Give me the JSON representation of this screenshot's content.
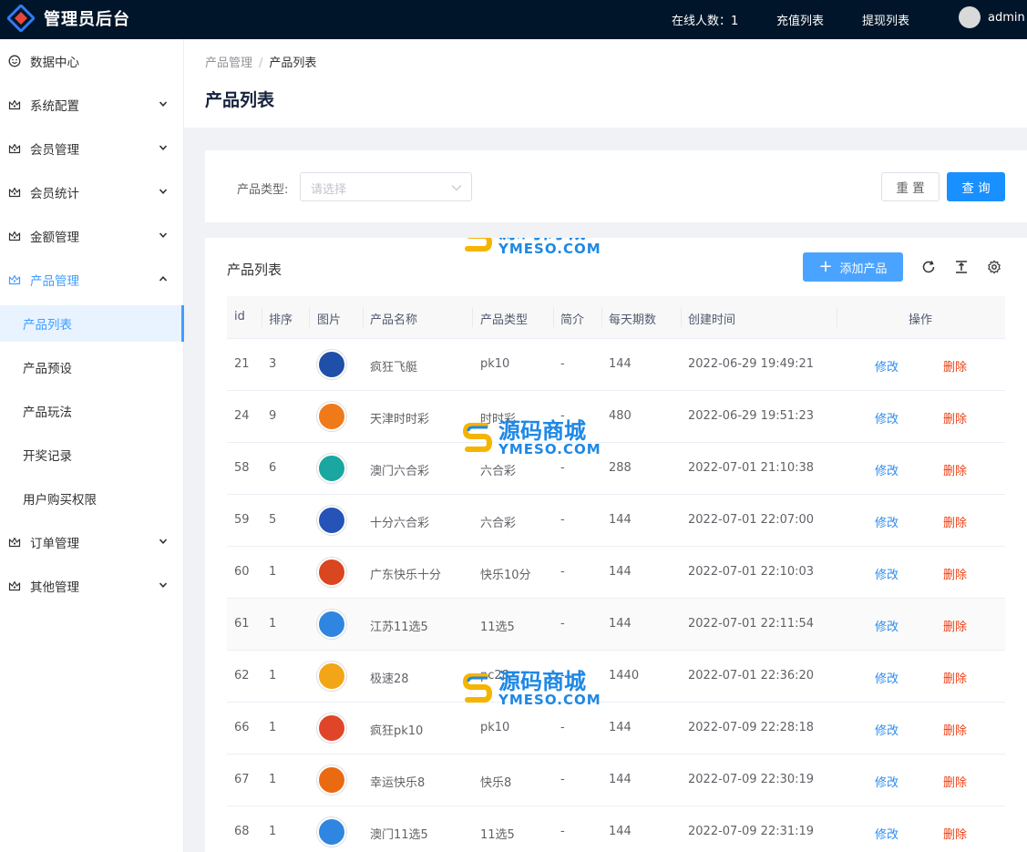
{
  "header": {
    "title": "管理员后台",
    "online_label": "在线人数：1",
    "links": [
      "充值列表",
      "提现列表"
    ],
    "username": "admin"
  },
  "sidebar": {
    "items": [
      {
        "label": "数据中心",
        "icon": "dashboard-icon",
        "has_arrow": false
      },
      {
        "label": "系统配置",
        "icon": "crown-icon",
        "has_arrow": true
      },
      {
        "label": "会员管理",
        "icon": "crown-icon",
        "has_arrow": true
      },
      {
        "label": "会员统计",
        "icon": "crown-icon",
        "has_arrow": true
      },
      {
        "label": "金额管理",
        "icon": "crown-icon",
        "has_arrow": true
      },
      {
        "label": "产品管理",
        "icon": "crown-icon",
        "has_arrow": true,
        "open": true
      },
      {
        "label": "订单管理",
        "icon": "crown-icon",
        "has_arrow": true
      },
      {
        "label": "其他管理",
        "icon": "crown-icon",
        "has_arrow": true
      }
    ],
    "sub_items": [
      "产品列表",
      "产品预设",
      "产品玩法",
      "开奖记录",
      "用户购买权限"
    ],
    "active_sub": "产品列表"
  },
  "breadcrumb": {
    "parent": "产品管理",
    "separator": "/",
    "current": "产品列表"
  },
  "page_title": "产品列表",
  "filter": {
    "label": "产品类型:",
    "placeholder": "请选择",
    "reset_label": "重 置",
    "query_label": "查 询"
  },
  "table_card": {
    "title": "产品列表",
    "add_label": "添加产品",
    "tool_icons": [
      "refresh-icon",
      "column-height-icon",
      "settings-icon"
    ],
    "columns": [
      "id",
      "排序",
      "图片",
      "产品名称",
      "产品类型",
      "简介",
      "每天期数",
      "创建时间",
      "操作"
    ],
    "edit_label": "修改",
    "delete_label": "删除",
    "rows": [
      {
        "id": "21",
        "sort": "3",
        "name": "疯狂飞艇",
        "type": "pk10",
        "intro": "-",
        "daily": "144",
        "created": "2022-06-29 19:49:21",
        "icon_color": "#1f4fa8"
      },
      {
        "id": "24",
        "sort": "9",
        "name": "天津时时彩",
        "type": "时时彩",
        "intro": "-",
        "daily": "480",
        "created": "2022-06-29 19:51:23",
        "icon_color": "#f07a1a"
      },
      {
        "id": "58",
        "sort": "6",
        "name": "澳门六合彩",
        "type": "六合彩",
        "intro": "-",
        "daily": "288",
        "created": "2022-07-01 21:10:38",
        "icon_color": "#19a7a0"
      },
      {
        "id": "59",
        "sort": "5",
        "name": "十分六合彩",
        "type": "六合彩",
        "intro": "-",
        "daily": "144",
        "created": "2022-07-01 22:07:00",
        "icon_color": "#2653b8"
      },
      {
        "id": "60",
        "sort": "1",
        "name": "广东快乐十分",
        "type": "快乐10分",
        "intro": "-",
        "daily": "144",
        "created": "2022-07-01 22:10:03",
        "icon_color": "#d9461f"
      },
      {
        "id": "61",
        "sort": "1",
        "name": "江苏11选5",
        "type": "11选5",
        "intro": "-",
        "daily": "144",
        "created": "2022-07-01 22:11:54",
        "icon_color": "#2f86e0"
      },
      {
        "id": "62",
        "sort": "1",
        "name": "极速28",
        "type": "pc28",
        "intro": "-",
        "daily": "1440",
        "created": "2022-07-01 22:36:20",
        "icon_color": "#f2a516"
      },
      {
        "id": "66",
        "sort": "1",
        "name": "疯狂pk10",
        "type": "pk10",
        "intro": "-",
        "daily": "144",
        "created": "2022-07-09 22:28:18",
        "icon_color": "#e0452a"
      },
      {
        "id": "67",
        "sort": "1",
        "name": "幸运快乐8",
        "type": "快乐8",
        "intro": "-",
        "daily": "144",
        "created": "2022-07-09 22:30:19",
        "icon_color": "#ea6a12"
      },
      {
        "id": "68",
        "sort": "1",
        "name": "澳门11选5",
        "type": "11选5",
        "intro": "-",
        "daily": "144",
        "created": "2022-07-09 22:31:19",
        "icon_color": "#2f86e0"
      }
    ]
  },
  "watermark": {
    "cn": "源码商城",
    "en": "YMESO.COM"
  },
  "colors": {
    "header_bg": "#001529",
    "primary": "#1890ff",
    "link": "#2d8cf0",
    "danger": "#ed4014",
    "active_bg": "#e8f3ff"
  }
}
